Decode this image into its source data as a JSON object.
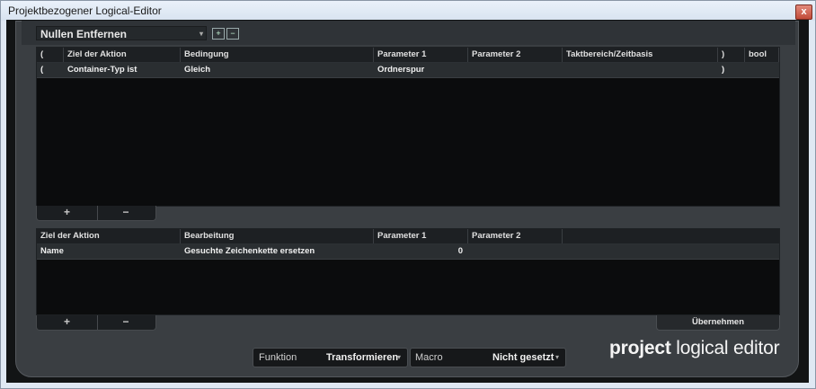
{
  "window": {
    "title": "Projektbezogener Logical-Editor",
    "close": "x"
  },
  "toolbar": {
    "preset": "Nullen Entfernen",
    "preset_arrow": "▾",
    "btn1": "+",
    "btn2": "−"
  },
  "filter_table": {
    "columns": [
      "(",
      "Ziel der Aktion",
      "Bedingung",
      "Parameter 1",
      "Parameter 2",
      "Taktbereich/Zeitbasis",
      ")",
      "bool"
    ],
    "rows": [
      [
        "(",
        "Container-Typ ist",
        "Gleich",
        "Ordnerspur",
        "",
        "",
        ")",
        ""
      ]
    ],
    "add": "+",
    "remove": "−"
  },
  "action_table": {
    "columns": [
      "Ziel der Aktion",
      "Bearbeitung",
      "Parameter 1",
      "Parameter 2"
    ],
    "rows": [
      [
        "Name",
        "Gesuchte Zeichenkette ersetzen",
        "0",
        ""
      ]
    ],
    "add": "+",
    "remove": "−"
  },
  "apply_label": "Übernehmen",
  "function": {
    "label": "Funktion",
    "value": "Transformieren"
  },
  "macro": {
    "label": "Macro",
    "value": "Nicht gesetzt"
  },
  "brand": {
    "bold": "project",
    "rest": " logical editor"
  },
  "colors": {
    "panel": "#3a3e42",
    "grid": "#0b0c0d",
    "row": "#2a2e31"
  }
}
